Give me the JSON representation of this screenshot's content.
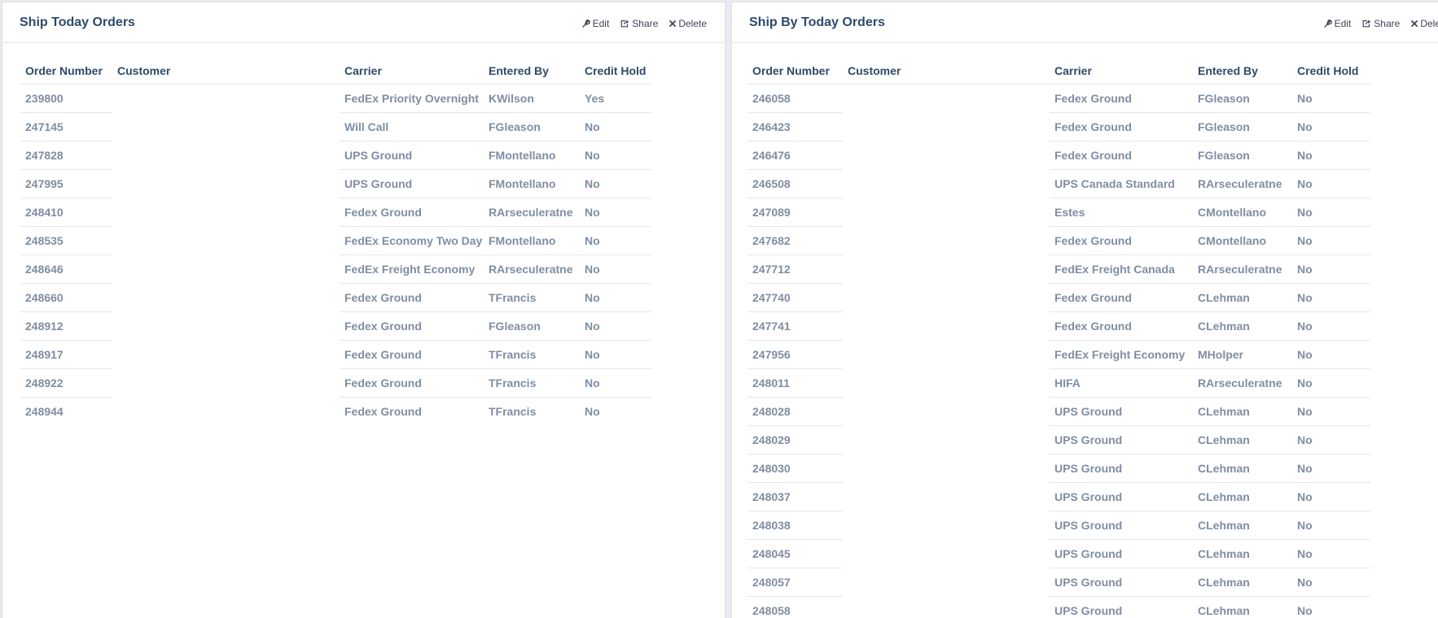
{
  "panels": [
    {
      "title": "Ship Today Orders",
      "actions": {
        "edit": "Edit",
        "share": "Share",
        "delete": "Delete"
      },
      "columns": [
        "Order Number",
        "Customer",
        "Carrier",
        "Entered By",
        "Credit Hold"
      ],
      "rows": [
        [
          "239800",
          "",
          "FedEx Priority Overnight",
          "KWilson",
          "Yes"
        ],
        [
          "247145",
          "",
          "Will Call",
          "FGleason",
          "No"
        ],
        [
          "247828",
          "",
          "UPS Ground",
          "FMontellano",
          "No"
        ],
        [
          "247995",
          "",
          "UPS Ground",
          "FMontellano",
          "No"
        ],
        [
          "248410",
          "",
          "Fedex Ground",
          "RArseculeratne",
          "No"
        ],
        [
          "248535",
          "",
          "FedEx Economy Two Day",
          "FMontellano",
          "No"
        ],
        [
          "248646",
          "",
          "FedEx Freight Economy",
          "RArseculeratne",
          "No"
        ],
        [
          "248660",
          "",
          "Fedex Ground",
          "TFrancis",
          "No"
        ],
        [
          "248912",
          "",
          "Fedex Ground",
          "FGleason",
          "No"
        ],
        [
          "248917",
          "",
          "Fedex Ground",
          "TFrancis",
          "No"
        ],
        [
          "248922",
          "",
          "Fedex Ground",
          "TFrancis",
          "No"
        ],
        [
          "248944",
          "",
          "Fedex Ground",
          "TFrancis",
          "No"
        ]
      ]
    },
    {
      "title": "Ship By Today Orders",
      "actions": {
        "edit": "Edit",
        "share": "Share",
        "delete": "Delete"
      },
      "columns": [
        "Order Number",
        "Customer",
        "Carrier",
        "Entered By",
        "Credit Hold"
      ],
      "rows": [
        [
          "246058",
          "",
          "Fedex Ground",
          "FGleason",
          "No"
        ],
        [
          "246423",
          "",
          "Fedex Ground",
          "FGleason",
          "No"
        ],
        [
          "246476",
          "",
          "Fedex Ground",
          "FGleason",
          "No"
        ],
        [
          "246508",
          "",
          "UPS Canada Standard",
          "RArseculeratne",
          "No"
        ],
        [
          "247089",
          "",
          "Estes",
          "CMontellano",
          "No"
        ],
        [
          "247682",
          "",
          "Fedex Ground",
          "CMontellano",
          "No"
        ],
        [
          "247712",
          "",
          "FedEx Freight Canada",
          "RArseculeratne",
          "No"
        ],
        [
          "247740",
          "",
          "Fedex Ground",
          "CLehman",
          "No"
        ],
        [
          "247741",
          "",
          "Fedex Ground",
          "CLehman",
          "No"
        ],
        [
          "247956",
          "",
          "FedEx Freight Economy",
          "MHolper",
          "No"
        ],
        [
          "248011",
          "",
          "HIFA",
          "RArseculeratne",
          "No"
        ],
        [
          "248028",
          "",
          "UPS Ground",
          "CLehman",
          "No"
        ],
        [
          "248029",
          "",
          "UPS Ground",
          "CLehman",
          "No"
        ],
        [
          "248030",
          "",
          "UPS Ground",
          "CLehman",
          "No"
        ],
        [
          "248037",
          "",
          "UPS Ground",
          "CLehman",
          "No"
        ],
        [
          "248038",
          "",
          "UPS Ground",
          "CLehman",
          "No"
        ],
        [
          "248045",
          "",
          "UPS Ground",
          "CLehman",
          "No"
        ],
        [
          "248057",
          "",
          "UPS Ground",
          "CLehman",
          "No"
        ],
        [
          "248058",
          "",
          "UPS Ground",
          "CLehman",
          "No"
        ]
      ]
    }
  ]
}
